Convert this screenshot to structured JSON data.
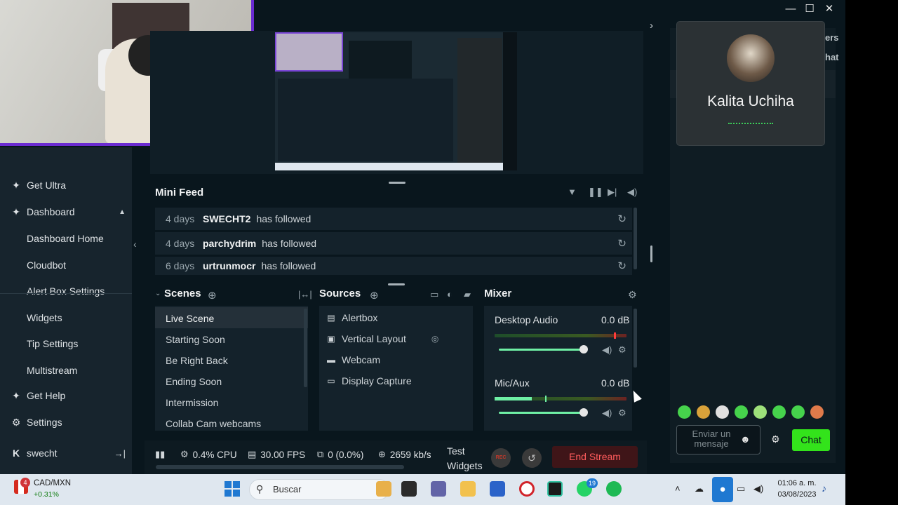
{
  "window": {
    "minimize": "—",
    "maximize": "☐",
    "close": "✕"
  },
  "nav": {
    "get_ultra": "Get Ultra",
    "dashboard": "Dashboard",
    "sub_items": [
      "Dashboard Home",
      "Cloudbot",
      "Alert Box Settings",
      "Widgets",
      "Tip Settings",
      "Multistream"
    ],
    "get_help": "Get Help",
    "settings": "Settings",
    "user": "swecht",
    "logo": "K"
  },
  "mini_feed": {
    "title": "Mini Feed",
    "rows": [
      {
        "days": "4 days",
        "user": "SWECHT2",
        "action": "has followed"
      },
      {
        "days": "4 days",
        "user": "parchydrim",
        "action": "has followed"
      },
      {
        "days": "6 days",
        "user": "urtrunmocr",
        "action": "has followed"
      }
    ]
  },
  "scenes": {
    "title": "Scenes",
    "items": [
      "Live Scene",
      "Starting Soon",
      "Be Right Back",
      "Ending Soon",
      "Intermission",
      "Collab Cam webcams"
    ]
  },
  "sources": {
    "title": "Sources",
    "items": [
      "Alertbox",
      "Vertical Layout",
      "Webcam",
      "Display Capture"
    ]
  },
  "mixer": {
    "title": "Mixer",
    "channels": [
      {
        "name": "Desktop Audio",
        "db": "0.0 dB",
        "level": 0.0,
        "volume": 1.0
      },
      {
        "name": "Mic/Aux",
        "db": "0.0 dB",
        "level": 0.28,
        "volume": 1.0
      }
    ]
  },
  "status": {
    "cpu": "0.4% CPU",
    "fps": "30.00 FPS",
    "dropped": "0 (0.0%)",
    "bitrate": "2659 kb/s",
    "test_widgets": "Test Widgets",
    "rec": "REC",
    "end_stream": "End Stream"
  },
  "call": {
    "name": "Kalita Uchiha"
  },
  "right_partial": {
    "line1": "ers",
    "line2": "hat"
  },
  "chat": {
    "placeholder": "Enviar un mensaje",
    "send": "Chat"
  },
  "taskbar": {
    "badge": "4",
    "ticker": "CAD/MXN",
    "change": "+0.31%",
    "search": "Buscar",
    "whatsapp_badge": "19",
    "time": "01:06 a. m.",
    "date": "03/08/2023"
  },
  "colors": {
    "accent_green": "#33e31b",
    "webcam_border": "#6b2bd1",
    "end_stream": "#ff5c5c"
  }
}
